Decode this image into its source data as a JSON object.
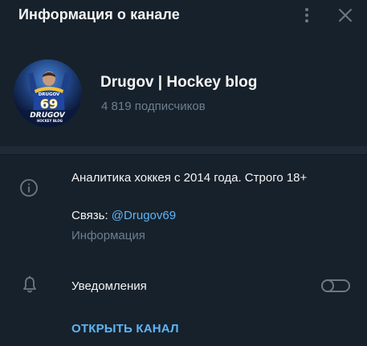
{
  "header": {
    "title": "Информация о канале",
    "menu_icon": "more-vertical-icon",
    "close_icon": "close-icon"
  },
  "profile": {
    "channel_name": "Drugov | Hockey blog",
    "subscribers": "4 819 подписчиков",
    "avatar": {
      "jersey_name": "DRUGOV",
      "jersey_number": "69",
      "logo_main": "DRUGOV",
      "logo_sub": "HOCKEY BLOG"
    }
  },
  "info": {
    "icon": "info-icon",
    "description": "Аналитика хоккея с 2014 года. Строго 18+",
    "link_prefix": "Связь: ",
    "link_text": "@Drugov69",
    "link_caption": "Информация"
  },
  "notifications": {
    "icon": "bell-icon",
    "label": "Уведомления",
    "enabled": false
  },
  "open_channel_label": "ОТКРЫТЬ КАНАЛ",
  "colors": {
    "background": "#17212b",
    "divider": "#1f2a36",
    "accent": "#5eb5f7",
    "muted_text": "#6d7f8f",
    "icon": "#6d7883",
    "text": "#f5f5f5"
  }
}
